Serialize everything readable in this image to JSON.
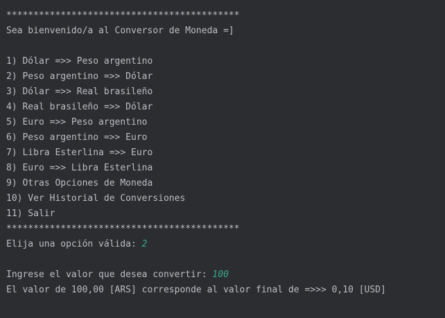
{
  "console": {
    "separator": "*******************************************",
    "welcome": "Sea bienvenido/a al Conversor de Moneda =]",
    "menu": [
      "1) Dólar =>> Peso argentino",
      "2) Peso argentino =>> Dólar",
      "3) Dólar =>> Real brasileño",
      "4) Real brasileño =>> Dólar",
      "5) Euro =>> Peso argentino",
      "6) Peso argentino =>> Euro",
      "7) Libra Esterlina =>> Euro",
      "8) Euro =>> Libra Esterlina",
      "9) Otras Opciones de Moneda",
      "10) Ver Historial de Conversiones",
      "11) Salir"
    ],
    "option_prompt": "Elija una opción válida: ",
    "option_input": "2",
    "amount_prompt": "Ingrese el valor que desea convertir: ",
    "amount_input": "100",
    "result": "El valor de 100,00 [ARS] corresponde al valor final de =>>> 0,10 [USD]"
  },
  "colors": {
    "background": "#2b2d30",
    "text": "#bcbec4",
    "user_input": "#3ba68c"
  }
}
